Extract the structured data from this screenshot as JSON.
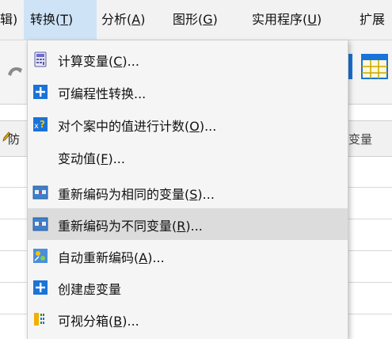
{
  "menubar": {
    "items": [
      {
        "prefix": "",
        "key": "",
        "suffix": "辑)",
        "id": "menu-edit"
      },
      {
        "prefix": "转换(",
        "key": "T",
        "suffix": ")",
        "id": "menu-transform"
      },
      {
        "prefix": "分析(",
        "key": "A",
        "suffix": ")",
        "id": "menu-analyze"
      },
      {
        "prefix": "图形(",
        "key": "G",
        "suffix": ")",
        "id": "menu-graphs"
      },
      {
        "prefix": "实用程序(",
        "key": "U",
        "suffix": ")",
        "id": "menu-utilities"
      },
      {
        "prefix": "扩展",
        "key": "",
        "suffix": "",
        "id": "menu-extensions"
      }
    ]
  },
  "background": {
    "col_left_label": "防",
    "col_right_label": "变量"
  },
  "dropdown": {
    "items": [
      {
        "prefix": "计算变量(",
        "key": "C",
        "suffix": ")...",
        "icon": "calculator-icon"
      },
      {
        "prefix": "可编程性转换...",
        "key": "",
        "suffix": "",
        "icon": "plus-icon"
      },
      {
        "prefix": "对个案中的值进行计数(",
        "key": "O",
        "suffix": ")...",
        "icon": "count-icon"
      },
      {
        "prefix": "变动值(",
        "key": "F",
        "suffix": ")...",
        "icon": ""
      },
      {
        "prefix": "重新编码为相同的变量(",
        "key": "S",
        "suffix": ")...",
        "icon": "recode-icon"
      },
      {
        "prefix": "重新编码为不同变量(",
        "key": "R",
        "suffix": ")...",
        "icon": "recode-icon"
      },
      {
        "prefix": "自动重新编码(",
        "key": "A",
        "suffix": ")...",
        "icon": "auto-recode-icon"
      },
      {
        "prefix": "创建虚变量",
        "key": "",
        "suffix": "",
        "icon": "plus-icon"
      },
      {
        "prefix": "可视分箱(",
        "key": "B",
        "suffix": ")...",
        "icon": "binning-icon"
      }
    ],
    "hover_index": 5
  },
  "colors": {
    "accent": "#1a73d8",
    "menubar_active": "#cfe3f7",
    "hover": "#dcdcdc"
  }
}
